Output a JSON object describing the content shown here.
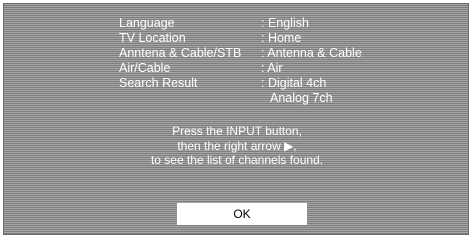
{
  "settings": [
    {
      "label": "Language",
      "value": ": English"
    },
    {
      "label": "TV Location",
      "value": ": Home"
    },
    {
      "label": "Anntena & Cable/STB",
      "value": ": Antenna & Cable"
    },
    {
      "label": "Air/Cable",
      "value": ": Air"
    },
    {
      "label": "Search Result",
      "value": ": Digital 4ch"
    }
  ],
  "search_result_extra": "Analog 7ch",
  "message": [
    "Press the INPUT button,",
    "then the right arrow ▶,",
    "to see the list of channels found."
  ],
  "ok_label": "OK"
}
